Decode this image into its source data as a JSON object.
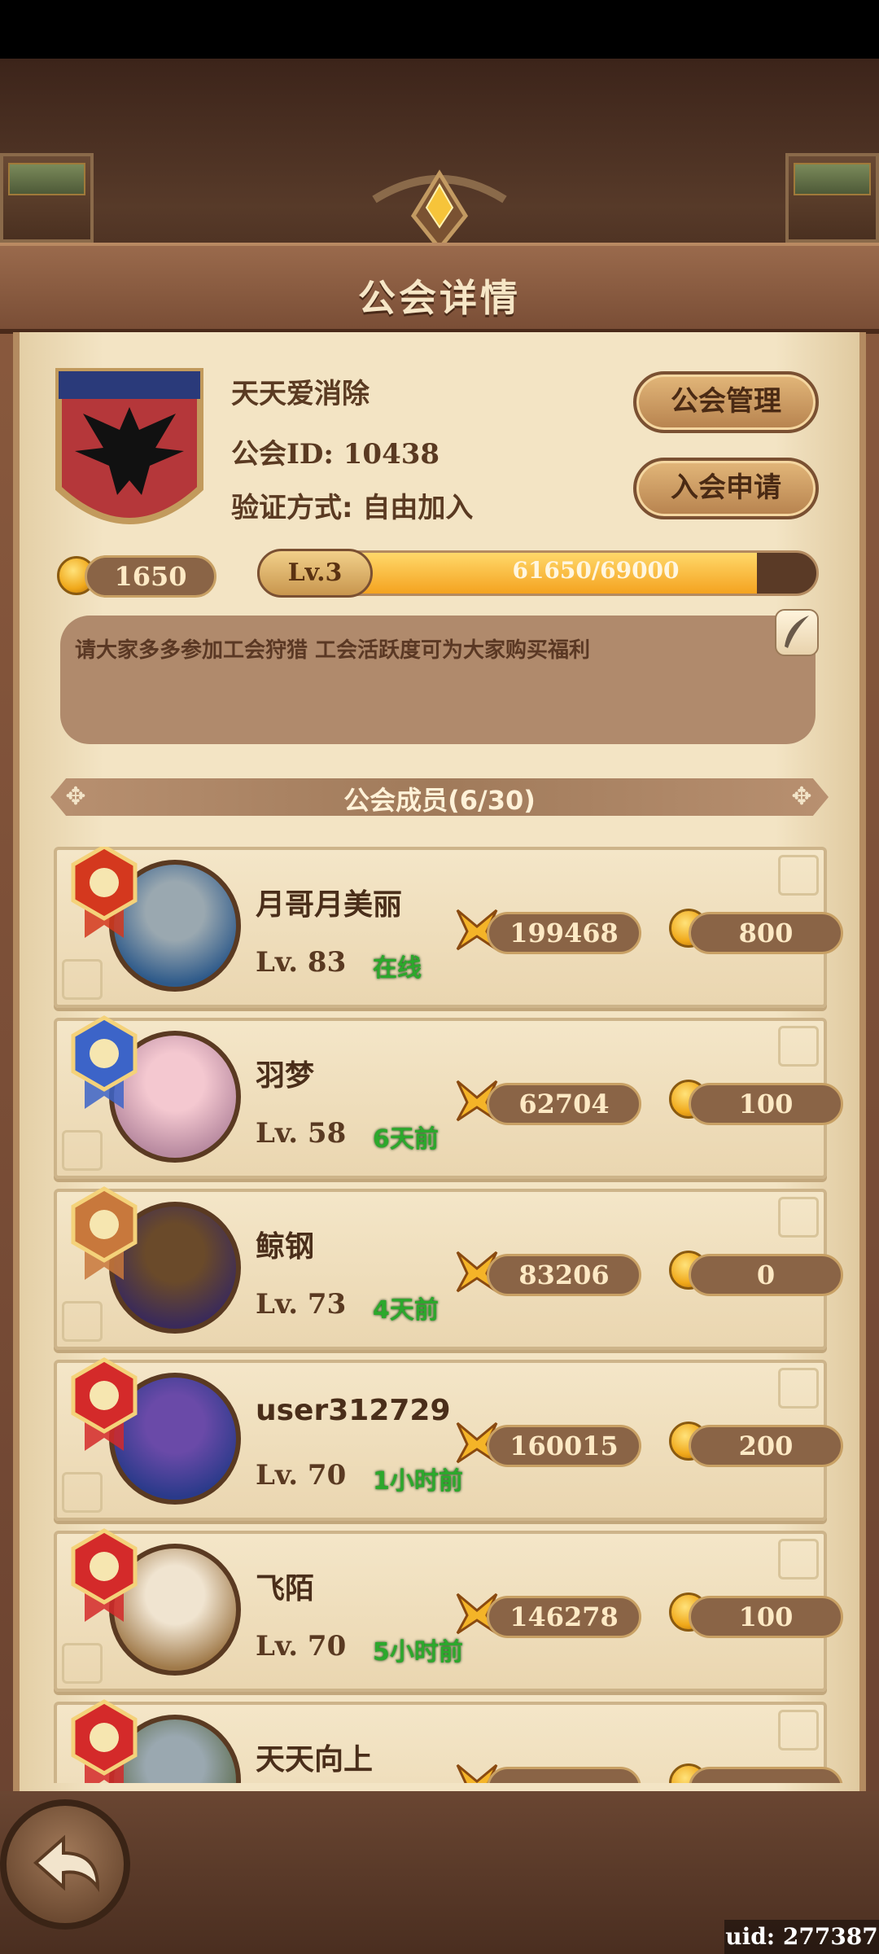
{
  "header": {
    "title": "公会详情"
  },
  "guild": {
    "name": "天天爱消除",
    "id_line": "公会ID: 10438",
    "verify_line": "验证方式: 自由加入",
    "coins": "1650",
    "level_tag": "Lv.3",
    "exp_text": "61650/69000",
    "exp_fraction": 0.893,
    "notice": "请大家多多参加工会狩猎 工会活跃度可为大家购买福利"
  },
  "buttons": {
    "manage": "公会管理",
    "apply": "入会申请"
  },
  "members_header": "公会成员(6/30)",
  "members": [
    {
      "name": "月哥月美丽",
      "level": "Lv. 83",
      "status": "在线",
      "power": "199468",
      "coins": "800",
      "badge": "gold-crown",
      "badge_color": "#d4381e"
    },
    {
      "name": "羽梦",
      "level": "Lv. 58",
      "status": "6天前",
      "power": "62704",
      "coins": "100",
      "badge": "silver-star",
      "badge_color": "#3c64c8"
    },
    {
      "name": "鲸钢",
      "level": "Lv. 73",
      "status": "4天前",
      "power": "83206",
      "coins": "0",
      "badge": "bronze-flame",
      "badge_color": "#c8783c"
    },
    {
      "name": "user312729",
      "level": "Lv. 70",
      "status": "1小时前",
      "power": "160015",
      "coins": "200",
      "badge": "red-swords",
      "badge_color": "#d42a2a"
    },
    {
      "name": "飞陌",
      "level": "Lv. 70",
      "status": "5小时前",
      "power": "146278",
      "coins": "100",
      "badge": "red-swords",
      "badge_color": "#d42a2a"
    },
    {
      "name": "天天向上",
      "level": "",
      "status": "",
      "power": "",
      "coins": "",
      "badge": "red-swords",
      "badge_color": "#d42a2a"
    }
  ],
  "footer": {
    "uid": "uid: 277387"
  }
}
